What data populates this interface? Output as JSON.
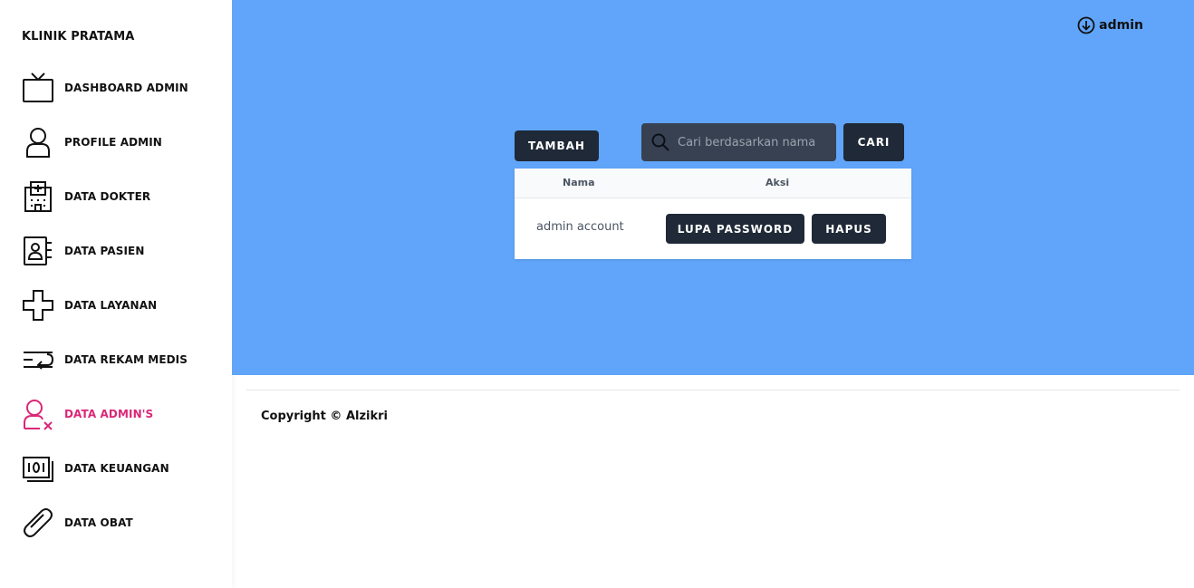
{
  "sidebar": {
    "brand": "KLINIK PRATAMA",
    "items": [
      {
        "label": "DASHBOARD ADMIN",
        "icon": "tv-icon"
      },
      {
        "label": "PROFILE ADMIN",
        "icon": "user-icon"
      },
      {
        "label": "DATA DOKTER",
        "icon": "hospital-icon"
      },
      {
        "label": "DATA PASIEN",
        "icon": "contact-card-icon"
      },
      {
        "label": "DATA LAYANAN",
        "icon": "medical-cross-icon"
      },
      {
        "label": "DATA REKAM MEDIS",
        "icon": "record-list-icon"
      },
      {
        "label": "DATA ADMIN'S",
        "icon": "user-remove-icon",
        "active": true
      },
      {
        "label": "DATA KEUANGAN",
        "icon": "money-icon"
      },
      {
        "label": "DATA OBAT",
        "icon": "pill-icon"
      }
    ],
    "active_color": "#db2777"
  },
  "header": {
    "user_label": "admin",
    "user_icon": "arrow-down-circle-icon"
  },
  "toolbar": {
    "add_label": "TAMBAH",
    "search_placeholder": "Cari berdasarkan nama",
    "search_value": "",
    "search_button_label": "CARI"
  },
  "table": {
    "columns": [
      "Nama",
      "Aksi"
    ],
    "rows": [
      {
        "name": "admin account",
        "actions": [
          "LUPA PASSWORD",
          "HAPUS"
        ]
      }
    ]
  },
  "footer": {
    "copyright": "Copyright © Alzikri"
  },
  "colors": {
    "main_bg": "#60a5fa",
    "button_bg": "#1f2937",
    "search_bg": "#374151"
  }
}
